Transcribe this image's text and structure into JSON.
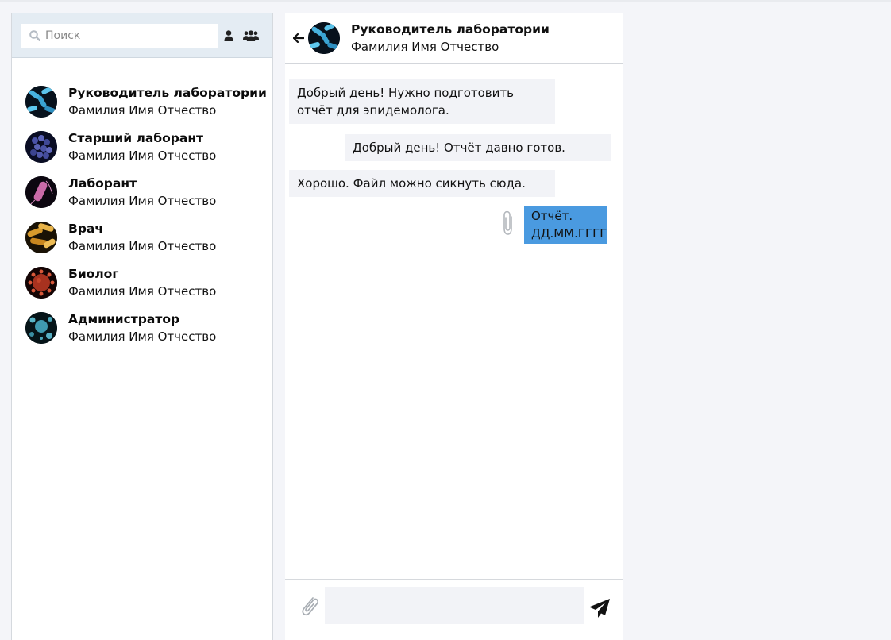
{
  "search": {
    "placeholder": "Поиск"
  },
  "contacts": [
    {
      "role": "Руководитель лаборатории",
      "name": "Фамилия Имя Отчество"
    },
    {
      "role": "Старший лаборант",
      "name": "Фамилия Имя Отчество"
    },
    {
      "role": "Лаборант",
      "name": "Фамилия Имя Отчество"
    },
    {
      "role": "Врач",
      "name": "Фамилия Имя Отчество"
    },
    {
      "role": "Биолог",
      "name": "Фамилия Имя Отчество"
    },
    {
      "role": "Администратор",
      "name": "Фамилия Имя Отчество"
    }
  ],
  "chat": {
    "header": {
      "role": "Руководитель лаборатории",
      "name": "Фамилия Имя Отчество"
    },
    "messages": [
      {
        "text": "Добрый день! Нужно подготовить отчёт для эпидемолога."
      },
      {
        "text": "Добрый день! Отчёт давно готов."
      },
      {
        "text": "Хорошо. Файл можно сикнуть сюда."
      }
    ],
    "file": {
      "line1": "Отчёт.",
      "line2": "ДД.ММ.ГГГГ"
    },
    "composer": {
      "placeholder": ""
    }
  },
  "icons": {
    "search": "search-icon",
    "user": "user-icon",
    "group": "group-icon",
    "back": "arrow-left-icon",
    "attach": "paperclip-icon",
    "send": "send-icon"
  },
  "colors": {
    "file_bubble": "#4a9ae0",
    "bubble": "#f2f3f7",
    "search_bar": "#e4ecf3"
  }
}
